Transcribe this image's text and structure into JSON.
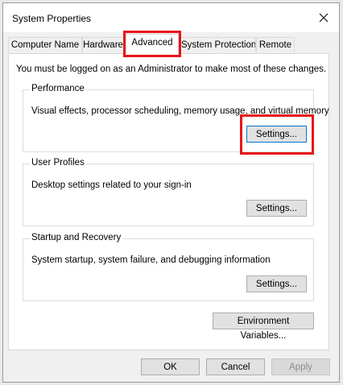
{
  "window": {
    "title": "System Properties"
  },
  "tabs": [
    {
      "label": "Computer Name",
      "active": false
    },
    {
      "label": "Hardware",
      "active": false
    },
    {
      "label": "Advanced",
      "active": true
    },
    {
      "label": "System Protection",
      "active": false
    },
    {
      "label": "Remote",
      "active": false
    }
  ],
  "panel": {
    "admin_note": "You must be logged on as an Administrator to make most of these changes.",
    "performance": {
      "title": "Performance",
      "description": "Visual effects, processor scheduling, memory usage, and virtual memory",
      "settings_label": "Settings..."
    },
    "user_profiles": {
      "title": "User Profiles",
      "description": "Desktop settings related to your sign-in",
      "settings_label": "Settings..."
    },
    "startup_recovery": {
      "title": "Startup and Recovery",
      "description": "System startup, system failure, and debugging information",
      "settings_label": "Settings..."
    },
    "env_vars_label": "Environment Variables..."
  },
  "footer": {
    "ok_label": "OK",
    "cancel_label": "Cancel",
    "apply_label": "Apply"
  },
  "colors": {
    "highlight": "#e8131a",
    "focus_border": "#0078d7"
  },
  "icons": {
    "close": "close-icon"
  }
}
